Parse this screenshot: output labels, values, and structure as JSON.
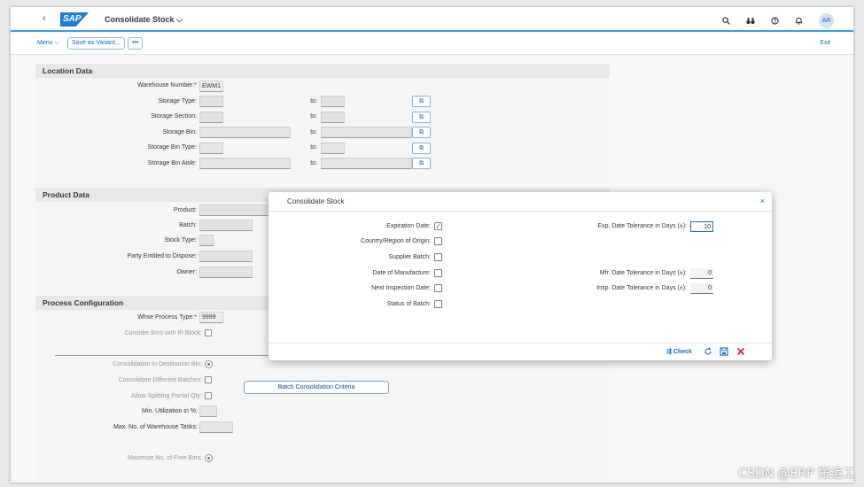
{
  "shell": {
    "back_glyph": "‹",
    "logo": "SAP",
    "title": "Consolidate Stock",
    "title_caret": "⌵",
    "icons": [
      "search-icon",
      "binoculars-icon",
      "help-icon",
      "bell-icon"
    ],
    "avatar": "AR"
  },
  "toolbar": {
    "menu": "Menu ⌵",
    "save_variant": "Save as Variant...",
    "more": "•••",
    "exit": "Exit"
  },
  "location": {
    "title": "Location Data",
    "warehouse_number_label": "Warehouse Number:",
    "warehouse_number_value": "EWM1",
    "to_label": "to:",
    "fields": [
      {
        "label": "Storage Type:"
      },
      {
        "label": "Storage Section:"
      },
      {
        "label": "Storage Bin:"
      },
      {
        "label": "Storage Bin Type:"
      },
      {
        "label": "Storage Bin Aisle:"
      }
    ]
  },
  "product": {
    "title": "Product Data",
    "fields": [
      {
        "label": "Product:"
      },
      {
        "label": "Batch:"
      },
      {
        "label": "Stock Type:"
      },
      {
        "label": "Party Entitled to Dispose:"
      },
      {
        "label": "Owner:"
      }
    ]
  },
  "process": {
    "title": "Process Configuration",
    "whse_process_type_label": "Whse Process Type:",
    "whse_process_type_value": "9999",
    "consider_bins_label": "Consider Bins with PI Block:",
    "consolidation_dest_label": "Consolidation in Destination Bin:",
    "consolidate_batches_label": "Consolidate Different Batches:",
    "batch_criteria_button": "Batch Consolidation Criteria",
    "allow_splitting_label": "Allow Splitting Partial Qty:",
    "min_utilization_label": "Min. Utilization in %:",
    "max_tasks_label": "Max. No. of Warehouse Tasks:",
    "maximize_free_bins_label": "Maximize No. of Free Bins:"
  },
  "dialog": {
    "title": "Consolidate Stock",
    "close": "×",
    "left_fields": [
      {
        "label": "Expiration Date:",
        "checked": true
      },
      {
        "label": "Country/Region of Origin:",
        "checked": false
      },
      {
        "label": "Supplier Batch:",
        "checked": false
      },
      {
        "label": "Date of Manufacture:",
        "checked": false
      },
      {
        "label": "Next Inspection Date:",
        "checked": false
      },
      {
        "label": "Status of Batch:",
        "checked": false
      }
    ],
    "exp_tolerance_label": "Exp. Date Tolerance in Days (±):",
    "exp_tolerance_value": "10",
    "mfr_tolerance_label": "Mfr. Date Tolerance in Days (±):",
    "mfr_tolerance_value": "0",
    "insp_tolerance_label": "Insp. Date Tolerance in Days (±):",
    "insp_tolerance_value": "0",
    "check_label": "Check",
    "footer_icons": [
      "check-icon",
      "reset-icon",
      "save-icon",
      "cancel-icon"
    ]
  },
  "watermark": "CSDN @ERP 搬运工",
  "colors": {
    "accent": "#0a6ed1",
    "shell_border": "#3aa0de",
    "cancel": "#e3171b"
  }
}
